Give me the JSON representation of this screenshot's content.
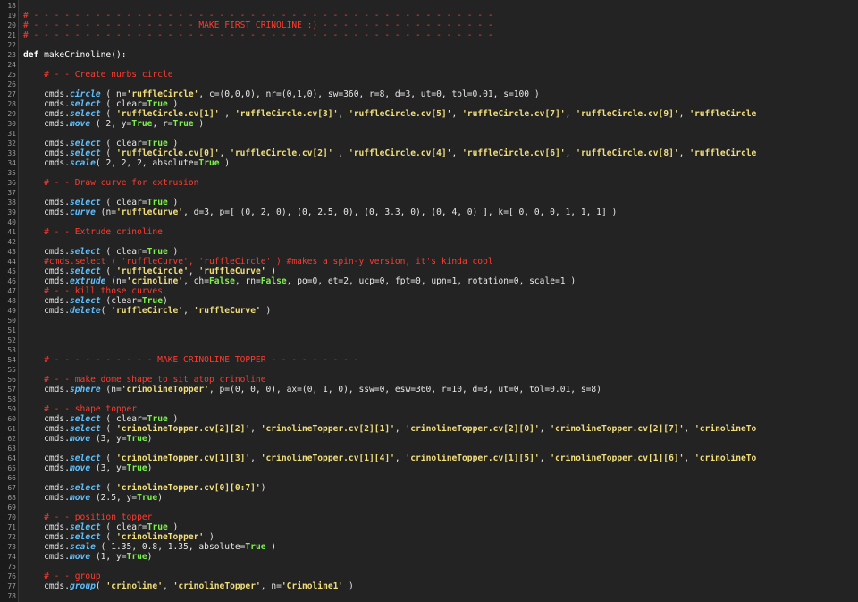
{
  "gutter": {
    "numbers": [
      "18",
      "19",
      "20",
      "21",
      "22",
      "23",
      "24",
      "25",
      "26",
      "27",
      "28",
      "29",
      "30",
      "31",
      "32",
      "33",
      "34",
      "35",
      "36",
      "37",
      "38",
      "39",
      "40",
      "41",
      "42",
      "43",
      "44",
      "45",
      "46",
      "47",
      "48",
      "49",
      "50",
      "51",
      "52",
      "53",
      "54",
      "55",
      "56",
      "57",
      "58",
      "59",
      "60",
      "61",
      "62",
      "63",
      "64",
      "65",
      "66",
      "67",
      "68",
      "69",
      "70",
      "71",
      "72",
      "73",
      "74",
      "75",
      "76",
      "77",
      "78"
    ]
  },
  "lines": [
    {
      "n": "18",
      "indent": 0,
      "tokens": []
    },
    {
      "n": "19",
      "indent": 0,
      "tokens": [
        {
          "t": "# - - - - - - - - - - - - - - - - - - - - - - - - - - - - - - - - - - - - - - - - - - - - -",
          "c": "cm"
        }
      ]
    },
    {
      "n": "20",
      "indent": 0,
      "tokens": [
        {
          "t": "# - - - - - - - - - - - - - - - - MAKE FIRST CRINOLINE :) - - - - - - - - - - - - - - - - -",
          "c": "cm"
        }
      ]
    },
    {
      "n": "21",
      "indent": 0,
      "tokens": [
        {
          "t": "# - - - - - - - - - - - - - - - - - - - - - - - - - - - - - - - - - - - - - - - - - - - - -",
          "c": "cm"
        }
      ]
    },
    {
      "n": "22",
      "indent": 0,
      "tokens": []
    },
    {
      "n": "23",
      "indent": 0,
      "tokens": [
        {
          "t": "def",
          "c": "kw"
        },
        {
          "t": " makeCrinoline():",
          "c": "def-name"
        }
      ]
    },
    {
      "n": "24",
      "indent": 0,
      "tokens": []
    },
    {
      "n": "25",
      "indent": 4,
      "tokens": [
        {
          "t": "# - - Create nurbs circle",
          "c": "cm"
        }
      ]
    },
    {
      "n": "26",
      "indent": 0,
      "tokens": []
    },
    {
      "n": "27",
      "indent": 4,
      "tokens": [
        {
          "t": "cmds."
        },
        {
          "t": "circle",
          "c": "fn"
        },
        {
          "t": " ( n="
        },
        {
          "t": "'ruffleCircle'",
          "c": "str"
        },
        {
          "t": ", c=(0,0,0), nr=(0,1,0), sw=360, r=8, d=3, ut=0, tol=0.01, s=100 )"
        }
      ]
    },
    {
      "n": "28",
      "indent": 4,
      "tokens": [
        {
          "t": "cmds."
        },
        {
          "t": "select",
          "c": "fn"
        },
        {
          "t": " ( clear="
        },
        {
          "t": "True",
          "c": "bool"
        },
        {
          "t": " )"
        }
      ]
    },
    {
      "n": "29",
      "indent": 4,
      "tokens": [
        {
          "t": "cmds."
        },
        {
          "t": "select",
          "c": "fn"
        },
        {
          "t": " ( "
        },
        {
          "t": "'ruffleCircle.cv[1]'",
          "c": "str"
        },
        {
          "t": " , "
        },
        {
          "t": "'ruffleCircle.cv[3]'",
          "c": "str"
        },
        {
          "t": ", "
        },
        {
          "t": "'ruffleCircle.cv[5]'",
          "c": "str"
        },
        {
          "t": ", "
        },
        {
          "t": "'ruffleCircle.cv[7]'",
          "c": "str"
        },
        {
          "t": ", "
        },
        {
          "t": "'ruffleCircle.cv[9]'",
          "c": "str"
        },
        {
          "t": ", "
        },
        {
          "t": "'ruffleCircle",
          "c": "str"
        }
      ]
    },
    {
      "n": "30",
      "indent": 4,
      "tokens": [
        {
          "t": "cmds."
        },
        {
          "t": "move",
          "c": "fn"
        },
        {
          "t": " ( 2, y="
        },
        {
          "t": "True",
          "c": "bool"
        },
        {
          "t": ", r="
        },
        {
          "t": "True",
          "c": "bool"
        },
        {
          "t": " )"
        }
      ]
    },
    {
      "n": "31",
      "indent": 0,
      "tokens": []
    },
    {
      "n": "32",
      "indent": 4,
      "tokens": [
        {
          "t": "cmds."
        },
        {
          "t": "select",
          "c": "fn"
        },
        {
          "t": " ( clear="
        },
        {
          "t": "True",
          "c": "bool"
        },
        {
          "t": " )"
        }
      ]
    },
    {
      "n": "33",
      "indent": 4,
      "tokens": [
        {
          "t": "cmds."
        },
        {
          "t": "select",
          "c": "fn"
        },
        {
          "t": " ( "
        },
        {
          "t": "'ruffleCircle.cv[0]'",
          "c": "str"
        },
        {
          "t": ", "
        },
        {
          "t": "'ruffleCircle.cv[2]'",
          "c": "str"
        },
        {
          "t": " , "
        },
        {
          "t": "'ruffleCircle.cv[4]'",
          "c": "str"
        },
        {
          "t": ", "
        },
        {
          "t": "'ruffleCircle.cv[6]'",
          "c": "str"
        },
        {
          "t": ", "
        },
        {
          "t": "'ruffleCircle.cv[8]'",
          "c": "str"
        },
        {
          "t": ", "
        },
        {
          "t": "'ruffleCircle",
          "c": "str"
        }
      ]
    },
    {
      "n": "34",
      "indent": 4,
      "tokens": [
        {
          "t": "cmds."
        },
        {
          "t": "scale",
          "c": "fn"
        },
        {
          "t": "( 2, 2, 2, absolute="
        },
        {
          "t": "True",
          "c": "bool"
        },
        {
          "t": " )"
        }
      ]
    },
    {
      "n": "35",
      "indent": 0,
      "tokens": []
    },
    {
      "n": "36",
      "indent": 4,
      "tokens": [
        {
          "t": "# - - Draw curve for extrusion",
          "c": "cm"
        }
      ]
    },
    {
      "n": "37",
      "indent": 0,
      "tokens": []
    },
    {
      "n": "38",
      "indent": 4,
      "tokens": [
        {
          "t": "cmds."
        },
        {
          "t": "select",
          "c": "fn"
        },
        {
          "t": " ( clear="
        },
        {
          "t": "True",
          "c": "bool"
        },
        {
          "t": " )"
        }
      ]
    },
    {
      "n": "39",
      "indent": 4,
      "tokens": [
        {
          "t": "cmds."
        },
        {
          "t": "curve",
          "c": "fn"
        },
        {
          "t": " (n="
        },
        {
          "t": "'ruffleCurve'",
          "c": "str"
        },
        {
          "t": ", d=3, p=[ (0, 2, 0), (0, 2.5, 0), (0, 3.3, 0), (0, 4, 0) ], k=[ 0, 0, 0, 1, 1, 1] )"
        }
      ]
    },
    {
      "n": "40",
      "indent": 0,
      "tokens": []
    },
    {
      "n": "41",
      "indent": 4,
      "tokens": [
        {
          "t": "# - - Extrude crinoline",
          "c": "cm"
        }
      ]
    },
    {
      "n": "42",
      "indent": 0,
      "tokens": []
    },
    {
      "n": "43",
      "indent": 4,
      "tokens": [
        {
          "t": "cmds."
        },
        {
          "t": "select",
          "c": "fn"
        },
        {
          "t": " ( clear="
        },
        {
          "t": "True",
          "c": "bool"
        },
        {
          "t": " )"
        }
      ]
    },
    {
      "n": "44",
      "indent": 4,
      "tokens": [
        {
          "t": "#cmds.select ( 'ruffleCurve', 'ruffleCircle' ) #makes a spin-y version, it's kinda cool",
          "c": "cm"
        }
      ]
    },
    {
      "n": "45",
      "indent": 4,
      "tokens": [
        {
          "t": "cmds."
        },
        {
          "t": "select",
          "c": "fn"
        },
        {
          "t": " ( "
        },
        {
          "t": "'ruffleCircle'",
          "c": "str"
        },
        {
          "t": ", "
        },
        {
          "t": "'ruffleCurve'",
          "c": "str"
        },
        {
          "t": " )"
        }
      ]
    },
    {
      "n": "46",
      "indent": 4,
      "tokens": [
        {
          "t": "cmds."
        },
        {
          "t": "extrude",
          "c": "fn"
        },
        {
          "t": " (n="
        },
        {
          "t": "'crinoline'",
          "c": "str"
        },
        {
          "t": ", ch="
        },
        {
          "t": "False",
          "c": "bool"
        },
        {
          "t": ", rn="
        },
        {
          "t": "False",
          "c": "bool"
        },
        {
          "t": ", po=0, et=2, ucp=0, fpt=0, upn=1, rotation=0, scale=1 )"
        }
      ]
    },
    {
      "n": "47",
      "indent": 4,
      "tokens": [
        {
          "t": "# - - kill those curves",
          "c": "cm"
        }
      ]
    },
    {
      "n": "48",
      "indent": 4,
      "tokens": [
        {
          "t": "cmds."
        },
        {
          "t": "select",
          "c": "fn"
        },
        {
          "t": " (clear="
        },
        {
          "t": "True",
          "c": "bool"
        },
        {
          "t": ")"
        }
      ]
    },
    {
      "n": "49",
      "indent": 4,
      "tokens": [
        {
          "t": "cmds."
        },
        {
          "t": "delete",
          "c": "fn"
        },
        {
          "t": "( "
        },
        {
          "t": "'ruffleCircle'",
          "c": "str"
        },
        {
          "t": ", "
        },
        {
          "t": "'ruffleCurve'",
          "c": "str"
        },
        {
          "t": " )"
        }
      ]
    },
    {
      "n": "50",
      "indent": 0,
      "tokens": []
    },
    {
      "n": "51",
      "indent": 0,
      "tokens": []
    },
    {
      "n": "52",
      "indent": 0,
      "tokens": []
    },
    {
      "n": "53",
      "indent": 0,
      "tokens": []
    },
    {
      "n": "54",
      "indent": 4,
      "tokens": [
        {
          "t": "# - - - - - - - - - - MAKE CRINOLINE TOPPER - - - - - - - - -",
          "c": "cm"
        }
      ]
    },
    {
      "n": "55",
      "indent": 0,
      "tokens": []
    },
    {
      "n": "56",
      "indent": 4,
      "tokens": [
        {
          "t": "# - - make dome shape to sit atop crinoline",
          "c": "cm"
        }
      ]
    },
    {
      "n": "57",
      "indent": 4,
      "tokens": [
        {
          "t": "cmds."
        },
        {
          "t": "sphere",
          "c": "fn"
        },
        {
          "t": " (n="
        },
        {
          "t": "'crinolineTopper'",
          "c": "str"
        },
        {
          "t": ", p=(0, 0, 0), ax=(0, 1, 0), ssw=0, esw=360, r=10, d=3, ut=0, tol=0.01, s=8)"
        }
      ]
    },
    {
      "n": "58",
      "indent": 0,
      "tokens": []
    },
    {
      "n": "59",
      "indent": 4,
      "tokens": [
        {
          "t": "# - - shape topper",
          "c": "cm"
        }
      ]
    },
    {
      "n": "60",
      "indent": 4,
      "tokens": [
        {
          "t": "cmds."
        },
        {
          "t": "select",
          "c": "fn"
        },
        {
          "t": " ( clear="
        },
        {
          "t": "True",
          "c": "bool"
        },
        {
          "t": " )"
        }
      ]
    },
    {
      "n": "61",
      "indent": 4,
      "tokens": [
        {
          "t": "cmds."
        },
        {
          "t": "select",
          "c": "fn"
        },
        {
          "t": " ( "
        },
        {
          "t": "'crinolineTopper.cv[2][2]'",
          "c": "str"
        },
        {
          "t": ", "
        },
        {
          "t": "'crinolineTopper.cv[2][1]'",
          "c": "str"
        },
        {
          "t": ", "
        },
        {
          "t": "'crinolineTopper.cv[2][0]'",
          "c": "str"
        },
        {
          "t": ", "
        },
        {
          "t": "'crinolineTopper.cv[2][7]'",
          "c": "str"
        },
        {
          "t": ", "
        },
        {
          "t": "'crinolineTo",
          "c": "str"
        }
      ]
    },
    {
      "n": "62",
      "indent": 4,
      "tokens": [
        {
          "t": "cmds."
        },
        {
          "t": "move",
          "c": "fn"
        },
        {
          "t": " (3, y="
        },
        {
          "t": "True",
          "c": "bool"
        },
        {
          "t": ")"
        }
      ]
    },
    {
      "n": "63",
      "indent": 0,
      "tokens": []
    },
    {
      "n": "64",
      "indent": 4,
      "tokens": [
        {
          "t": "cmds."
        },
        {
          "t": "select",
          "c": "fn"
        },
        {
          "t": " ( "
        },
        {
          "t": "'crinolineTopper.cv[1][3]'",
          "c": "str"
        },
        {
          "t": ", "
        },
        {
          "t": "'crinolineTopper.cv[1][4]'",
          "c": "str"
        },
        {
          "t": ", "
        },
        {
          "t": "'crinolineTopper.cv[1][5]'",
          "c": "str"
        },
        {
          "t": ", "
        },
        {
          "t": "'crinolineTopper.cv[1][6]'",
          "c": "str"
        },
        {
          "t": ", "
        },
        {
          "t": "'crinolineTo",
          "c": "str"
        }
      ]
    },
    {
      "n": "65",
      "indent": 4,
      "tokens": [
        {
          "t": "cmds."
        },
        {
          "t": "move",
          "c": "fn"
        },
        {
          "t": " (3, y="
        },
        {
          "t": "True",
          "c": "bool"
        },
        {
          "t": ")"
        }
      ]
    },
    {
      "n": "66",
      "indent": 0,
      "tokens": []
    },
    {
      "n": "67",
      "indent": 4,
      "tokens": [
        {
          "t": "cmds."
        },
        {
          "t": "select",
          "c": "fn"
        },
        {
          "t": " ( "
        },
        {
          "t": "'crinolineTopper.cv[0][0:7]'",
          "c": "str"
        },
        {
          "t": ")"
        }
      ]
    },
    {
      "n": "68",
      "indent": 4,
      "tokens": [
        {
          "t": "cmds."
        },
        {
          "t": "move",
          "c": "fn"
        },
        {
          "t": " (2.5, y="
        },
        {
          "t": "True",
          "c": "bool"
        },
        {
          "t": ")"
        }
      ]
    },
    {
      "n": "69",
      "indent": 0,
      "tokens": []
    },
    {
      "n": "70",
      "indent": 4,
      "tokens": [
        {
          "t": "# - - position topper",
          "c": "cm"
        }
      ]
    },
    {
      "n": "71",
      "indent": 4,
      "tokens": [
        {
          "t": "cmds."
        },
        {
          "t": "select",
          "c": "fn"
        },
        {
          "t": " ( clear="
        },
        {
          "t": "True",
          "c": "bool"
        },
        {
          "t": " )"
        }
      ]
    },
    {
      "n": "72",
      "indent": 4,
      "tokens": [
        {
          "t": "cmds."
        },
        {
          "t": "select",
          "c": "fn"
        },
        {
          "t": " ( "
        },
        {
          "t": "'crinolineTopper'",
          "c": "str"
        },
        {
          "t": " )"
        }
      ]
    },
    {
      "n": "73",
      "indent": 4,
      "tokens": [
        {
          "t": "cmds."
        },
        {
          "t": "scale",
          "c": "fn"
        },
        {
          "t": " ( 1.35, 0.8, 1.35, absolute="
        },
        {
          "t": "True",
          "c": "bool"
        },
        {
          "t": " )"
        }
      ]
    },
    {
      "n": "74",
      "indent": 4,
      "tokens": [
        {
          "t": "cmds."
        },
        {
          "t": "move",
          "c": "fn"
        },
        {
          "t": " (1, y="
        },
        {
          "t": "True",
          "c": "bool"
        },
        {
          "t": ")"
        }
      ]
    },
    {
      "n": "75",
      "indent": 0,
      "tokens": []
    },
    {
      "n": "76",
      "indent": 4,
      "tokens": [
        {
          "t": "# - - group",
          "c": "cm"
        }
      ]
    },
    {
      "n": "77",
      "indent": 4,
      "tokens": [
        {
          "t": "cmds."
        },
        {
          "t": "group",
          "c": "fn"
        },
        {
          "t": "( "
        },
        {
          "t": "'crinoline'",
          "c": "str"
        },
        {
          "t": ", "
        },
        {
          "t": "'crinolineTopper'",
          "c": "str"
        },
        {
          "t": ", n="
        },
        {
          "t": "'Crinoline1'",
          "c": "str"
        },
        {
          "t": " )"
        }
      ]
    },
    {
      "n": "78",
      "indent": 0,
      "tokens": []
    }
  ],
  "colors": {
    "background": "#232323",
    "gutter": "#1b1b1b",
    "comment": "#ff3b2f",
    "string": "#f2df7b",
    "function": "#5fc0ff",
    "boolean": "#7cf24a",
    "text": "#e8e8e8"
  }
}
